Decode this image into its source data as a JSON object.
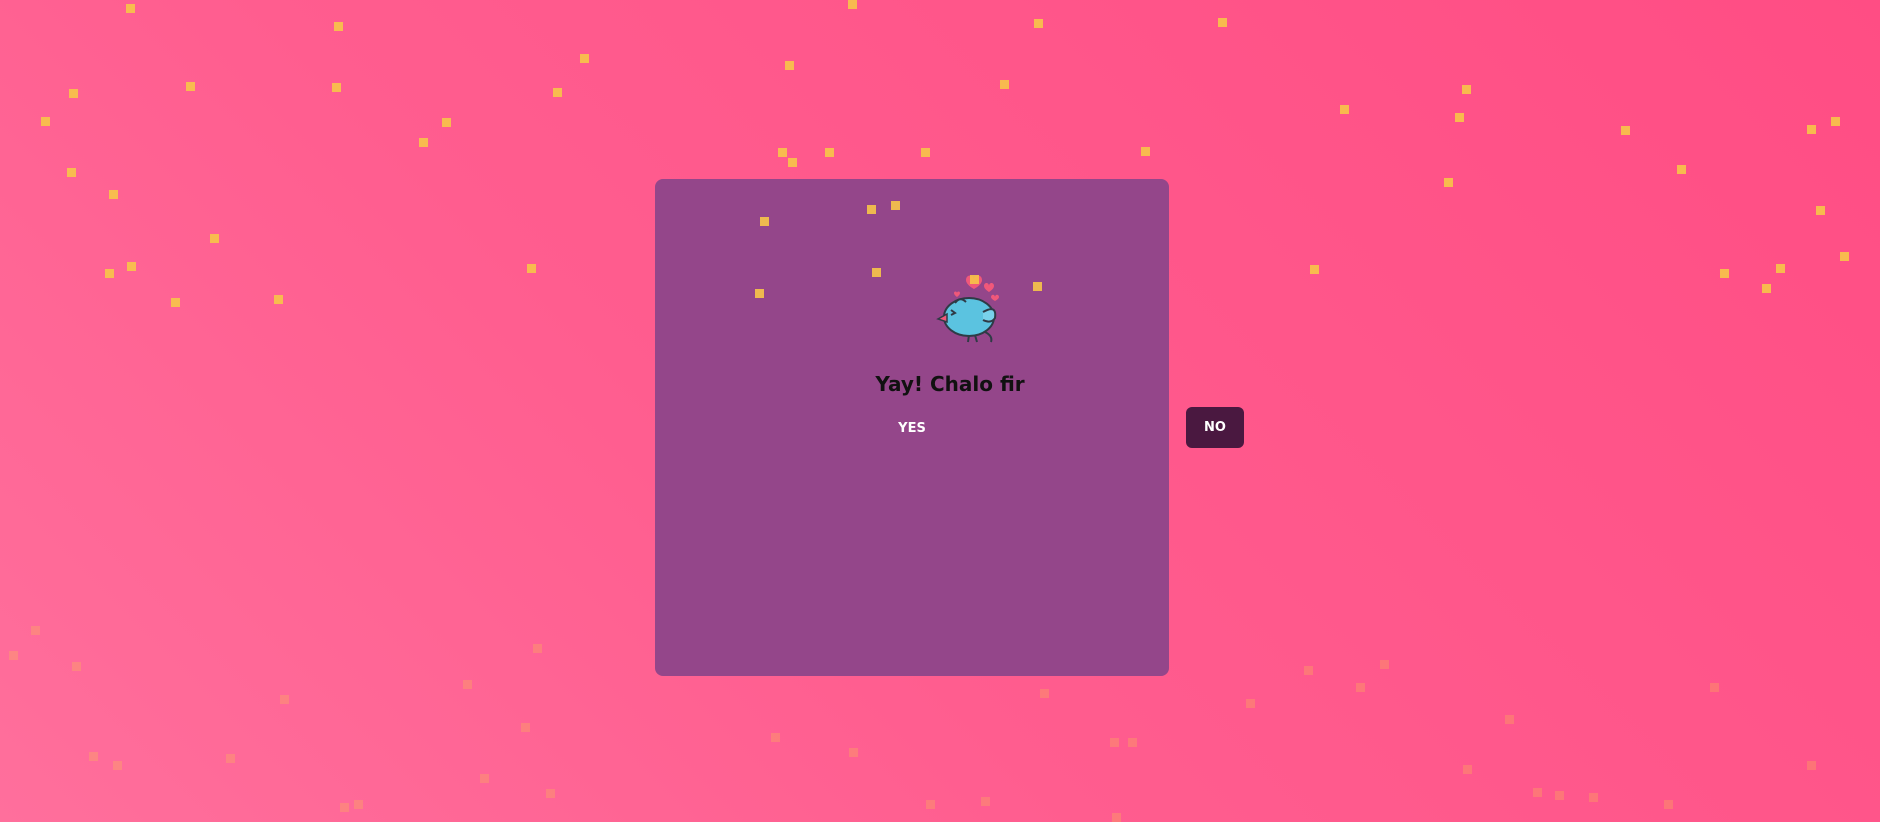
{
  "colors": {
    "card": "#94468a",
    "no_button_bg": "#4a1840",
    "confetti": "#f7c548"
  },
  "mascot": {
    "icon": "blue-bird-with-hearts-icon"
  },
  "card": {
    "heading": "Yay! Chalo fir"
  },
  "buttons": {
    "yes_label": "YES",
    "no_label": "NO"
  }
}
